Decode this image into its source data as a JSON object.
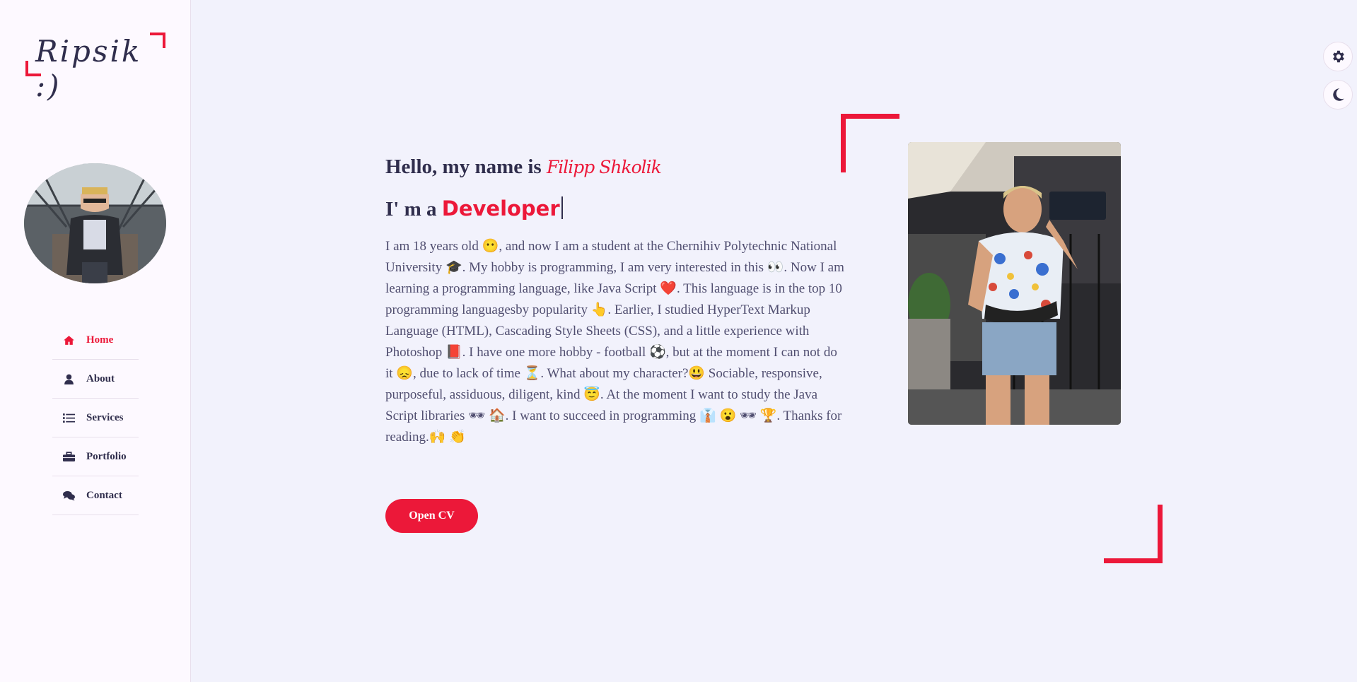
{
  "logo": {
    "text": "Ripsik :)"
  },
  "nav": [
    {
      "label": "Home",
      "icon": "home-icon",
      "active": true
    },
    {
      "label": "About",
      "icon": "user-icon",
      "active": false
    },
    {
      "label": "Services",
      "icon": "list-icon",
      "active": false
    },
    {
      "label": "Portfolio",
      "icon": "briefcase-icon",
      "active": false
    },
    {
      "label": "Contact",
      "icon": "comments-icon",
      "active": false
    }
  ],
  "controls": {
    "settings_icon": "gear-icon",
    "theme_icon": "moon-icon"
  },
  "hero": {
    "greeting": "Hello, my name is ",
    "name": "Filipp Shkolik",
    "role_prefix": "I' m a ",
    "role": "Developer",
    "bio": "I am 18 years old 😶, and now I am a student at the Chernihiv Polytechnic National University 🎓. My hobby is programming, I am very interested in this 👀. Now I am learning a programming language, like Java Script ❤️. This language is in the top 10 programming languagesby popularity 👆. Earlier, I studied HyperText Markup Language (HTML), Cascading Style Sheets (CSS), and a little experience with Photoshop 📕. I have one more hobby - football ⚽, but at the moment I can not do it 😞, due to lack of time ⏳. What about my character?😃 Sociable, responsive, purposeful, assiduous, diligent, kind 😇. At the moment I want to study the Java Script libraries 🕶 🏠. I want to succeed in programming 👔 😮 🕶 🏆. Thanks for reading.🙌 👏",
    "cv_button": "Open CV"
  },
  "colors": {
    "accent": "#ec1839",
    "text": "#302e4d",
    "background": "#f2f2fc",
    "sidebar": "#fdf9ff"
  }
}
